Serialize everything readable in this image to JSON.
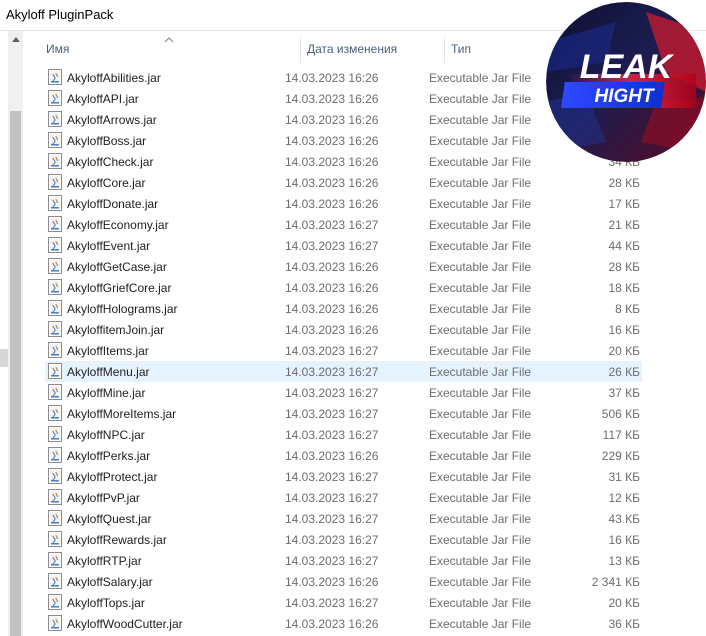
{
  "window": {
    "title": "Akyloff PluginPack"
  },
  "columns": {
    "name": "Имя",
    "date": "Дата изменения",
    "type": "Тип"
  },
  "logo": {
    "line1": "LEAK",
    "line2": "HIGHT"
  },
  "colors": {
    "selection": "#e5f3ff",
    "header_text": "#4c607a",
    "logo_red": "#e0202e",
    "logo_blue": "#1537e8"
  },
  "files": [
    {
      "name": "AkyloffAbilities.jar",
      "date": "14.03.2023 16:26",
      "type": "Executable Jar File",
      "size": ""
    },
    {
      "name": "AkyloffAPI.jar",
      "date": "14.03.2023 16:26",
      "type": "Executable Jar File",
      "size": ""
    },
    {
      "name": "AkyloffArrows.jar",
      "date": "14.03.2023 16:26",
      "type": "Executable Jar File",
      "size": ""
    },
    {
      "name": "AkyloffBoss.jar",
      "date": "14.03.2023 16:26",
      "type": "Executable Jar File",
      "size": ""
    },
    {
      "name": "AkyloffCheck.jar",
      "date": "14.03.2023 16:26",
      "type": "Executable Jar File",
      "size": "34 КБ"
    },
    {
      "name": "AkyloffCore.jar",
      "date": "14.03.2023 16:26",
      "type": "Executable Jar File",
      "size": "28 КБ"
    },
    {
      "name": "AkyloffDonate.jar",
      "date": "14.03.2023 16:26",
      "type": "Executable Jar File",
      "size": "17 КБ"
    },
    {
      "name": "AkyloffEconomy.jar",
      "date": "14.03.2023 16:27",
      "type": "Executable Jar File",
      "size": "21 КБ"
    },
    {
      "name": "AkyloffEvent.jar",
      "date": "14.03.2023 16:27",
      "type": "Executable Jar File",
      "size": "44 КБ"
    },
    {
      "name": "AkyloffGetCase.jar",
      "date": "14.03.2023 16:26",
      "type": "Executable Jar File",
      "size": "28 КБ"
    },
    {
      "name": "AkyloffGriefCore.jar",
      "date": "14.03.2023 16:26",
      "type": "Executable Jar File",
      "size": "18 КБ"
    },
    {
      "name": "AkyloffHolograms.jar",
      "date": "14.03.2023 16:26",
      "type": "Executable Jar File",
      "size": "8 КБ"
    },
    {
      "name": "AkyloffitemJoin.jar",
      "date": "14.03.2023 16:26",
      "type": "Executable Jar File",
      "size": "16 КБ"
    },
    {
      "name": "AkyloffItems.jar",
      "date": "14.03.2023 16:27",
      "type": "Executable Jar File",
      "size": "20 КБ"
    },
    {
      "name": "AkyloffMenu.jar",
      "date": "14.03.2023 16:27",
      "type": "Executable Jar File",
      "size": "26 КБ",
      "selected": true
    },
    {
      "name": "AkyloffMine.jar",
      "date": "14.03.2023 16:27",
      "type": "Executable Jar File",
      "size": "37 КБ"
    },
    {
      "name": "AkyloffMoreItems.jar",
      "date": "14.03.2023 16:27",
      "type": "Executable Jar File",
      "size": "506 КБ"
    },
    {
      "name": "AkyloffNPC.jar",
      "date": "14.03.2023 16:27",
      "type": "Executable Jar File",
      "size": "117 КБ"
    },
    {
      "name": "AkyloffPerks.jar",
      "date": "14.03.2023 16:26",
      "type": "Executable Jar File",
      "size": "229 КБ"
    },
    {
      "name": "AkyloffProtect.jar",
      "date": "14.03.2023 16:27",
      "type": "Executable Jar File",
      "size": "31 КБ"
    },
    {
      "name": "AkyloffPvP.jar",
      "date": "14.03.2023 16:27",
      "type": "Executable Jar File",
      "size": "12 КБ"
    },
    {
      "name": "AkyloffQuest.jar",
      "date": "14.03.2023 16:27",
      "type": "Executable Jar File",
      "size": "43 КБ"
    },
    {
      "name": "AkyloffRewards.jar",
      "date": "14.03.2023 16:27",
      "type": "Executable Jar File",
      "size": "16 КБ"
    },
    {
      "name": "AkyloffRTP.jar",
      "date": "14.03.2023 16:27",
      "type": "Executable Jar File",
      "size": "13 КБ"
    },
    {
      "name": "AkyloffSalary.jar",
      "date": "14.03.2023 16:26",
      "type": "Executable Jar File",
      "size": "2 341 КБ"
    },
    {
      "name": "AkyloffTops.jar",
      "date": "14.03.2023 16:27",
      "type": "Executable Jar File",
      "size": "20 КБ"
    },
    {
      "name": "AkyloffWoodCutter.jar",
      "date": "14.03.2023 16:26",
      "type": "Executable Jar File",
      "size": "36 КБ"
    }
  ]
}
